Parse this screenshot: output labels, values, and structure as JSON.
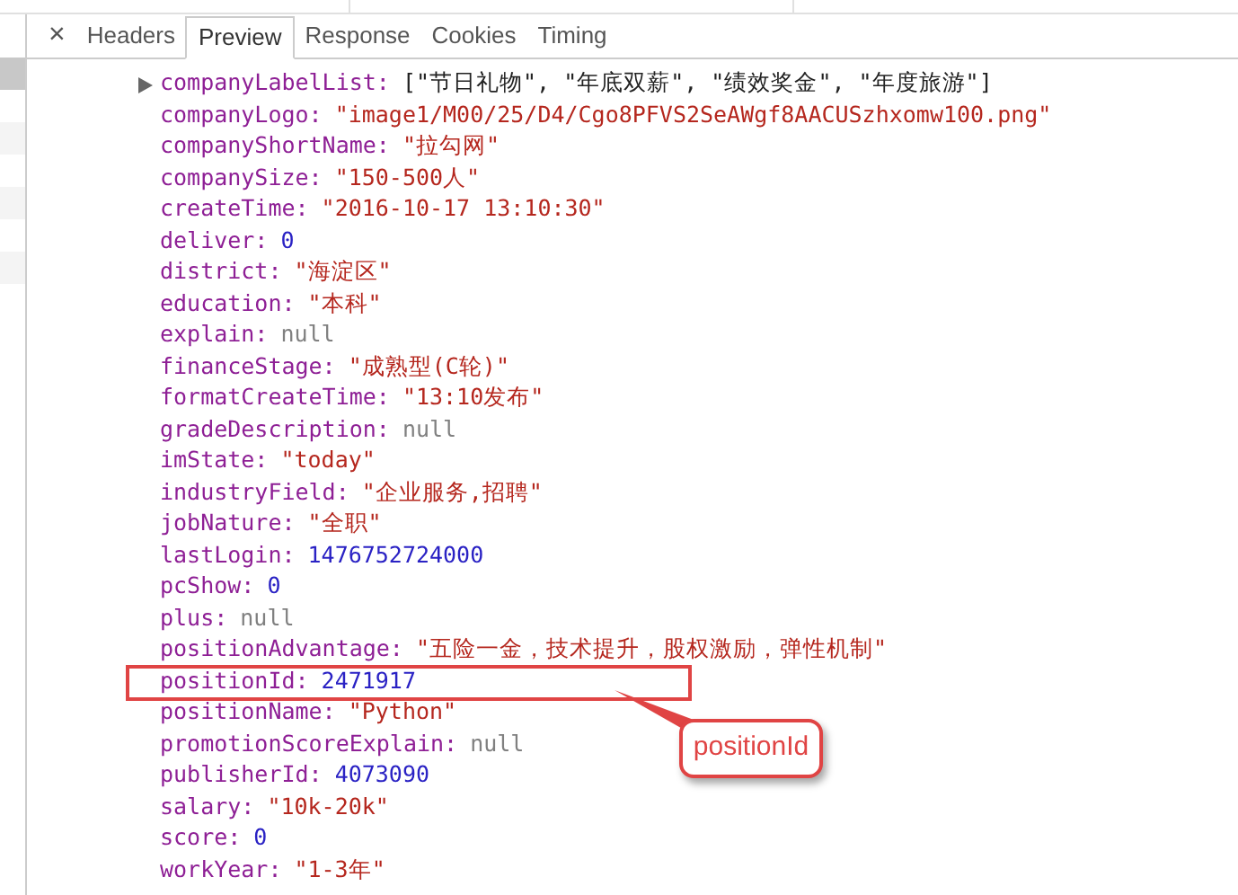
{
  "tabs": [
    {
      "label": "Headers",
      "selected": false
    },
    {
      "label": "Preview",
      "selected": true
    },
    {
      "label": "Response",
      "selected": false
    },
    {
      "label": "Cookies",
      "selected": false
    },
    {
      "label": "Timing",
      "selected": false
    }
  ],
  "close_button": "×",
  "request_rows": [
    {
      "selected": true
    },
    {
      "selected": false
    },
    {
      "selected": false
    },
    {
      "selected": false
    }
  ],
  "rows": [
    {
      "key": "companyLabelList:",
      "value": "[\"节日礼物\", \"年底双薪\", \"绩效奖金\", \"年度旅游\"]",
      "kind": "array",
      "expanded": false,
      "highlighted": false
    },
    {
      "key": "companyLogo:",
      "value": "\"image1/M00/25/D4/Cgo8PFVS2SeAWgf8AACUSzhxomw100.png\"",
      "kind": "string",
      "highlighted": false
    },
    {
      "key": "companyShortName:",
      "value": "\"拉勾网\"",
      "kind": "string",
      "highlighted": false
    },
    {
      "key": "companySize:",
      "value": "\"150-500人\"",
      "kind": "string",
      "highlighted": false
    },
    {
      "key": "createTime:",
      "value": "\"2016-10-17 13:10:30\"",
      "kind": "string",
      "highlighted": false
    },
    {
      "key": "deliver:",
      "value": "0",
      "kind": "number",
      "highlighted": false
    },
    {
      "key": "district:",
      "value": "\"海淀区\"",
      "kind": "string",
      "highlighted": false
    },
    {
      "key": "education:",
      "value": "\"本科\"",
      "kind": "string",
      "highlighted": false
    },
    {
      "key": "explain:",
      "value": "null",
      "kind": "null",
      "highlighted": false
    },
    {
      "key": "financeStage:",
      "value": "\"成熟型(C轮)\"",
      "kind": "string",
      "highlighted": false
    },
    {
      "key": "formatCreateTime:",
      "value": "\"13:10发布\"",
      "kind": "string",
      "highlighted": false
    },
    {
      "key": "gradeDescription:",
      "value": "null",
      "kind": "null",
      "highlighted": false
    },
    {
      "key": "imState:",
      "value": "\"today\"",
      "kind": "string",
      "highlighted": false
    },
    {
      "key": "industryField:",
      "value": "\"企业服务,招聘\"",
      "kind": "string",
      "highlighted": false
    },
    {
      "key": "jobNature:",
      "value": "\"全职\"",
      "kind": "string",
      "highlighted": false
    },
    {
      "key": "lastLogin:",
      "value": "1476752724000",
      "kind": "number",
      "highlighted": false
    },
    {
      "key": "pcShow:",
      "value": "0",
      "kind": "number",
      "highlighted": false
    },
    {
      "key": "plus:",
      "value": "null",
      "kind": "null",
      "highlighted": false
    },
    {
      "key": "positionAdvantage:",
      "value": "\"五险一金，技术提升，股权激励，弹性机制\"",
      "kind": "string",
      "highlighted": false
    },
    {
      "key": "positionId:",
      "value": "2471917",
      "kind": "number",
      "highlighted": true
    },
    {
      "key": "positionName:",
      "value": "\"Python\"",
      "kind": "string",
      "highlighted": false
    },
    {
      "key": "promotionScoreExplain:",
      "value": "null",
      "kind": "null",
      "highlighted": false
    },
    {
      "key": "publisherId:",
      "value": "4073090",
      "kind": "number",
      "highlighted": false
    },
    {
      "key": "salary:",
      "value": "\"10k-20k\"",
      "kind": "string",
      "highlighted": false
    },
    {
      "key": "score:",
      "value": "0",
      "kind": "number",
      "highlighted": false
    },
    {
      "key": "workYear:",
      "value": "\"1-3年\"",
      "kind": "string",
      "highlighted": false
    }
  ],
  "callout": {
    "label": "positionId"
  }
}
